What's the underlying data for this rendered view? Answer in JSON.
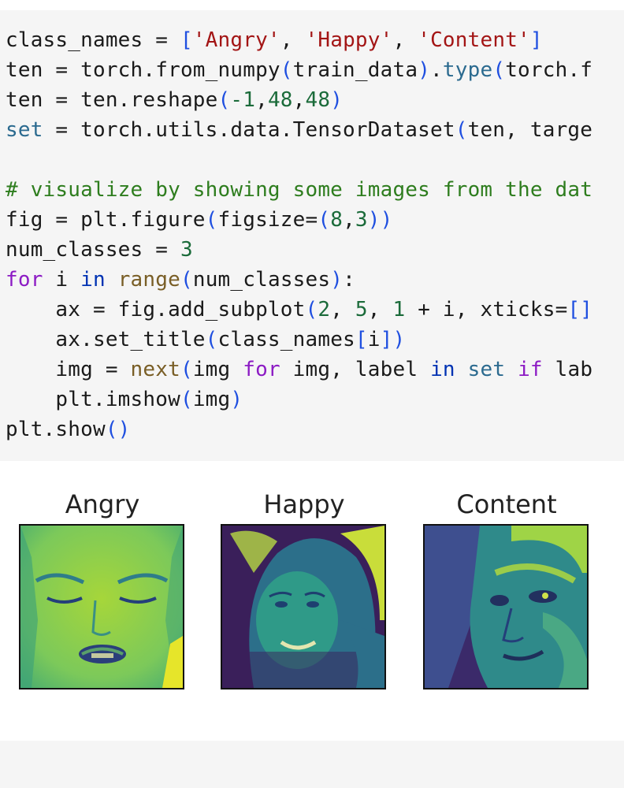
{
  "code_cell": {
    "lines": [
      [
        {
          "t": "class_names = "
        },
        {
          "t": "[",
          "c": "t-paren"
        },
        {
          "t": "'Angry'",
          "c": "t-str"
        },
        {
          "t": ", "
        },
        {
          "t": "'Happy'",
          "c": "t-str"
        },
        {
          "t": ", "
        },
        {
          "t": "'Content'",
          "c": "t-str"
        },
        {
          "t": "]",
          "c": "t-paren"
        }
      ],
      [
        {
          "t": "ten = torch.from_numpy"
        },
        {
          "t": "(",
          "c": "t-paren"
        },
        {
          "t": "train_data"
        },
        {
          "t": ")",
          "c": "t-paren"
        },
        {
          "t": "."
        },
        {
          "t": "type",
          "c": "t-var"
        },
        {
          "t": "(",
          "c": "t-paren"
        },
        {
          "t": "torch.f"
        }
      ],
      [
        {
          "t": "ten = ten.reshape"
        },
        {
          "t": "(",
          "c": "t-paren"
        },
        {
          "t": "-1",
          "c": "t-num"
        },
        {
          "t": ","
        },
        {
          "t": "48",
          "c": "t-num"
        },
        {
          "t": ","
        },
        {
          "t": "48",
          "c": "t-num"
        },
        {
          "t": ")",
          "c": "t-paren"
        }
      ],
      [
        {
          "t": "set",
          "c": "t-var"
        },
        {
          "t": " = torch.utils.data.TensorDataset"
        },
        {
          "t": "(",
          "c": "t-paren"
        },
        {
          "t": "ten, targe"
        }
      ],
      [
        {
          "t": ""
        }
      ],
      [
        {
          "t": "# visualize by showing some images from the dat",
          "c": "t-cm"
        }
      ],
      [
        {
          "t": "fig = plt.figure"
        },
        {
          "t": "(",
          "c": "t-paren"
        },
        {
          "t": "figsize="
        },
        {
          "t": "(",
          "c": "t-paren"
        },
        {
          "t": "8",
          "c": "t-num"
        },
        {
          "t": ","
        },
        {
          "t": "3",
          "c": "t-num"
        },
        {
          "t": "))",
          "c": "t-paren"
        }
      ],
      [
        {
          "t": "num_classes = "
        },
        {
          "t": "3",
          "c": "t-num"
        }
      ],
      [
        {
          "t": "for",
          "c": "t-kw"
        },
        {
          "t": " i "
        },
        {
          "t": "in",
          "c": "t-kw2"
        },
        {
          "t": " "
        },
        {
          "t": "range",
          "c": "t-fn"
        },
        {
          "t": "(",
          "c": "t-paren"
        },
        {
          "t": "num_classes"
        },
        {
          "t": ")",
          "c": "t-paren"
        },
        {
          "t": ":"
        }
      ],
      [
        {
          "t": "    ax = fig.add_subplot"
        },
        {
          "t": "(",
          "c": "t-paren"
        },
        {
          "t": "2",
          "c": "t-num"
        },
        {
          "t": ", "
        },
        {
          "t": "5",
          "c": "t-num"
        },
        {
          "t": ", "
        },
        {
          "t": "1",
          "c": "t-num"
        },
        {
          "t": " + i, xticks="
        },
        {
          "t": "[]",
          "c": "t-paren"
        }
      ],
      [
        {
          "t": "    ax.set_title"
        },
        {
          "t": "(",
          "c": "t-paren"
        },
        {
          "t": "class_names"
        },
        {
          "t": "[",
          "c": "t-paren"
        },
        {
          "t": "i"
        },
        {
          "t": "])",
          "c": "t-paren"
        }
      ],
      [
        {
          "t": "    img = "
        },
        {
          "t": "next",
          "c": "t-fn"
        },
        {
          "t": "(",
          "c": "t-paren"
        },
        {
          "t": "img "
        },
        {
          "t": "for",
          "c": "t-kw"
        },
        {
          "t": " img, label "
        },
        {
          "t": "in",
          "c": "t-kw2"
        },
        {
          "t": " "
        },
        {
          "t": "set",
          "c": "t-var"
        },
        {
          "t": " "
        },
        {
          "t": "if",
          "c": "t-kw"
        },
        {
          "t": " lab"
        }
      ],
      [
        {
          "t": "    plt.imshow"
        },
        {
          "t": "(",
          "c": "t-paren"
        },
        {
          "t": "img"
        },
        {
          "t": ")",
          "c": "t-paren"
        }
      ],
      [
        {
          "t": "plt.show"
        },
        {
          "t": "()",
          "c": "t-paren"
        }
      ]
    ]
  },
  "output": {
    "panels": [
      {
        "title": "Angry"
      },
      {
        "title": "Happy"
      },
      {
        "title": "Content"
      }
    ]
  },
  "colors": {
    "cell_bg": "#f5f5f5",
    "string": "#a31515",
    "keyword": "#8c1bc4",
    "number": "#1b6b3a",
    "comment": "#2e7d1e",
    "viridis_dark": "#3b1f5c",
    "viridis_mid": "#2f8c8a",
    "viridis_bright": "#d8e22a"
  }
}
